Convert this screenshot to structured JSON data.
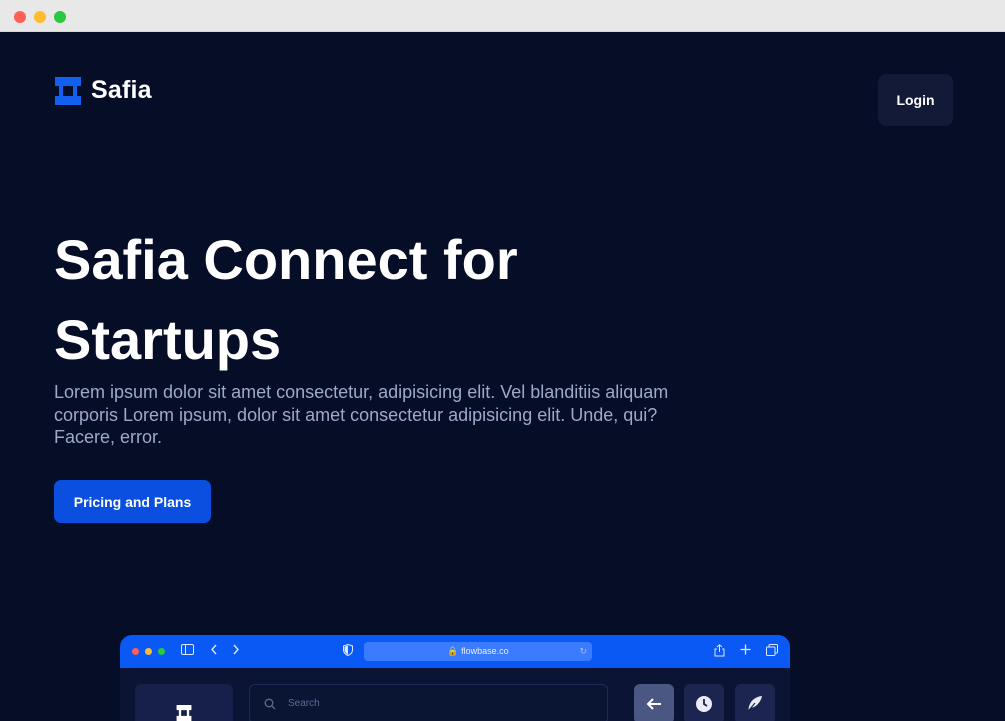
{
  "brand": {
    "name": "Safia",
    "accent": "#0a4fdf"
  },
  "nav": {
    "login_label": "Login"
  },
  "hero": {
    "title": "Safia Connect for Startups",
    "description": "Lorem ipsum dolor sit amet consectetur, adipisicing elit. Vel blanditiis aliquam corporis Lorem ipsum, dolor sit amet consectetur adipisicing elit. Unde, qui? Facere, error.",
    "cta_label": "Pricing and Plans"
  },
  "mockup": {
    "url": "flowbase.co",
    "search_placeholder": "Search",
    "bar_color": "#0a59f5",
    "icons": [
      "sidebar-icon",
      "back-icon",
      "forward-icon",
      "shield-icon",
      "lock-icon",
      "share-icon",
      "plus-icon",
      "tabs-icon",
      "arrow-left-icon",
      "clock-icon",
      "feather-icon"
    ]
  }
}
